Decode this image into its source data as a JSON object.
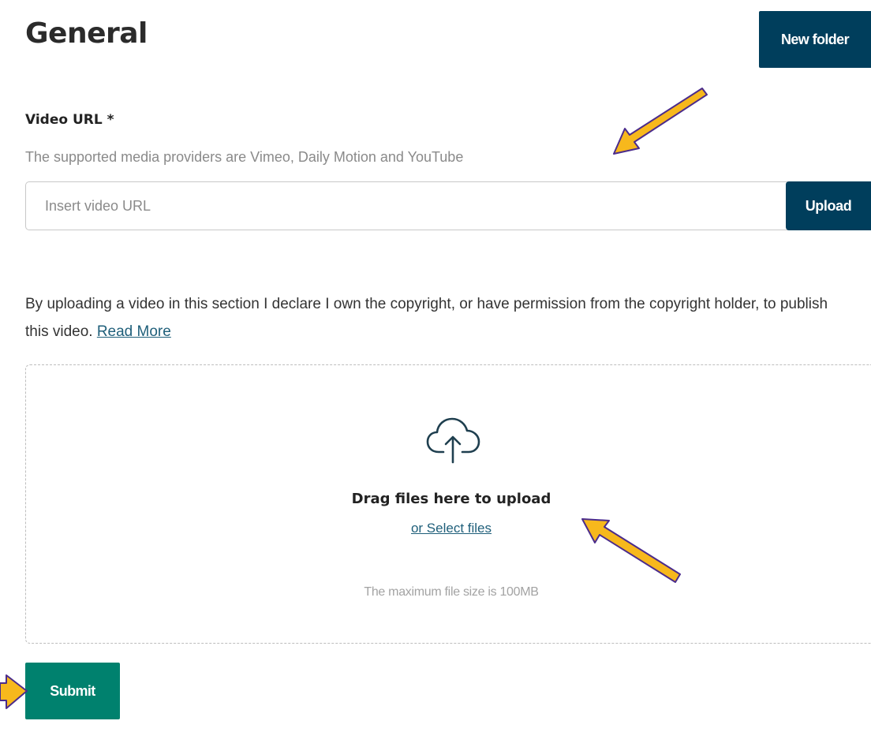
{
  "header": {
    "title": "General",
    "new_folder_label": "New folder"
  },
  "video_url": {
    "label": "Video URL *",
    "hint": "The supported media providers are Vimeo, Daily Motion and YouTube",
    "placeholder": "Insert video URL",
    "value": "",
    "upload_label": "Upload"
  },
  "declaration": {
    "text": "By uploading a video in this section I declare I own the copyright, or have permission from the copyright holder, to publish this video.",
    "link_label": "Read More"
  },
  "dropzone": {
    "icon": "cloud-upload-icon",
    "title": "Drag files here to upload",
    "select_label": "or Select files",
    "max_size": "The maximum file size is 100MB"
  },
  "footer": {
    "submit_label": "Submit"
  },
  "colors": {
    "primary_dark": "#003e5c",
    "submit_green": "#00816e",
    "link": "#1f5f7a",
    "annotation_arrow_fill": "#f7b81c",
    "annotation_arrow_stroke": "#4b2c8c"
  }
}
